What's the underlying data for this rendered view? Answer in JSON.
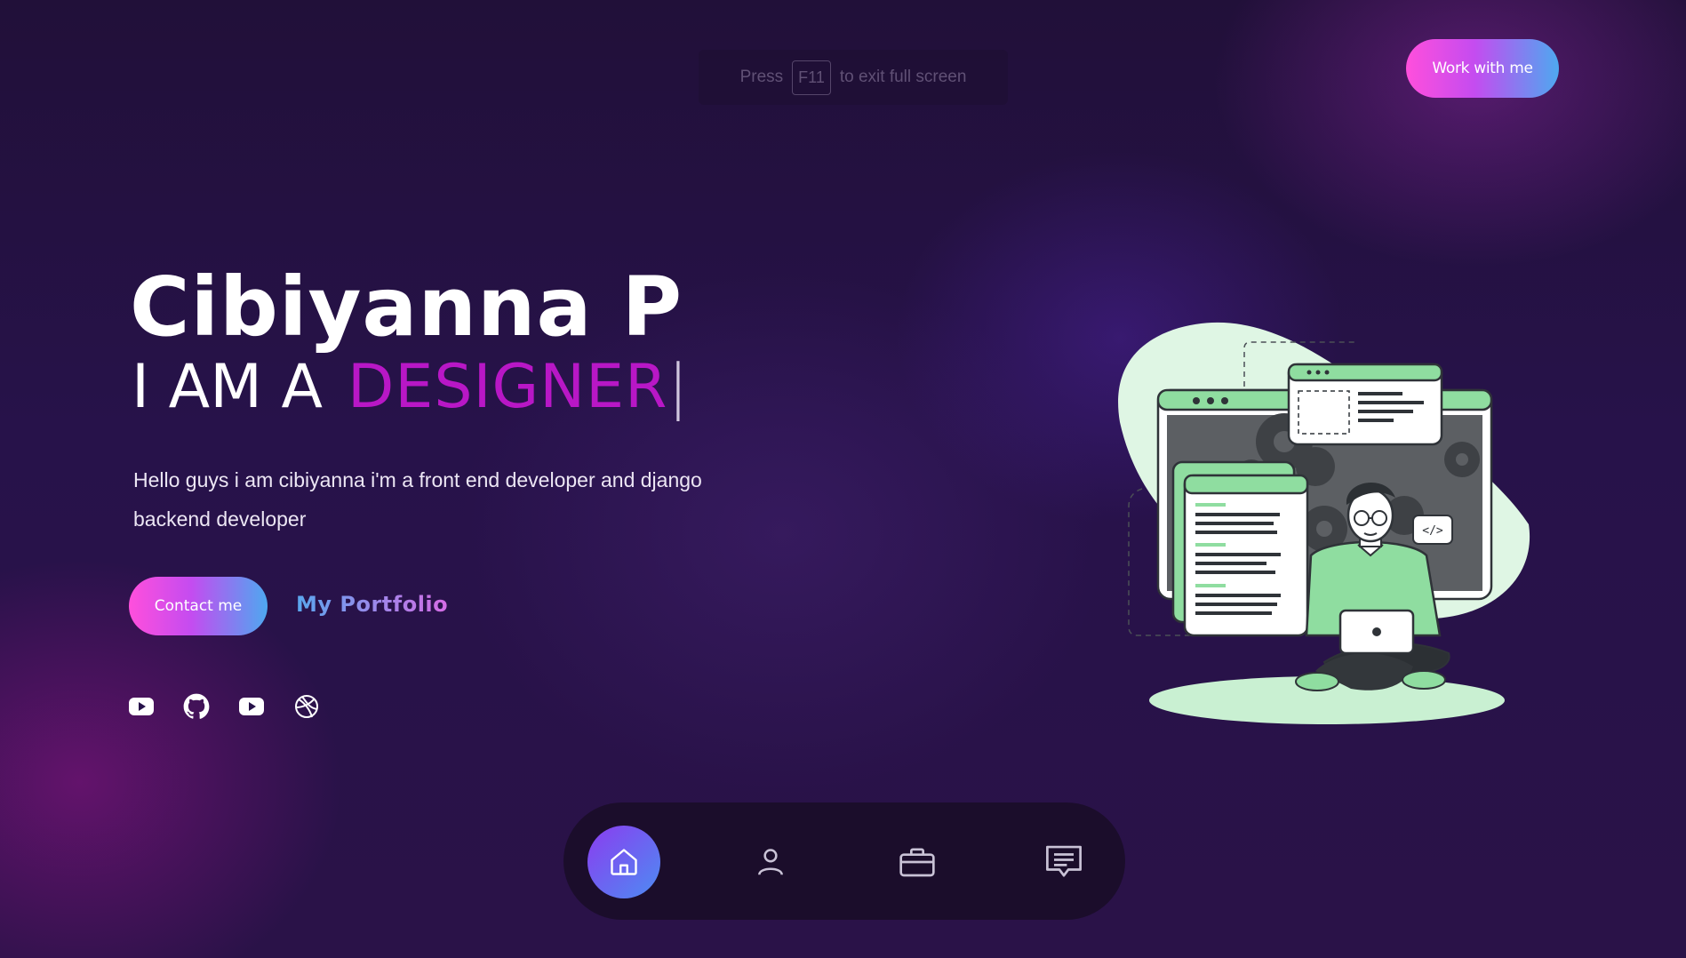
{
  "overlay": {
    "press": "Press",
    "key": "F11",
    "suffix": "to exit full screen"
  },
  "header": {
    "cta_label": "Work with me"
  },
  "hero": {
    "name": "Cibiyanna P",
    "role_prefix": "I AM A",
    "role_word": "DESIGNER",
    "caret": "|",
    "description": "Hello guys i am cibiyanna i'm a front end developer and django backend developer",
    "contact_label": "Contact me",
    "portfolio_label": "My Portfolio"
  },
  "socials": [
    {
      "icon": "youtube-icon"
    },
    {
      "icon": "github-icon"
    },
    {
      "icon": "youtube-icon"
    },
    {
      "icon": "dribbble-icon"
    }
  ],
  "bottom_nav": [
    {
      "icon": "home-icon",
      "active": true
    },
    {
      "icon": "user-icon",
      "active": false
    },
    {
      "icon": "briefcase-icon",
      "active": false
    },
    {
      "icon": "message-icon",
      "active": false
    }
  ],
  "colors": {
    "accent_pink": "#ff4fdc",
    "accent_blue": "#4ea8f0",
    "role_magenta": "#b817c6",
    "illustration_green": "#8fdda0",
    "background": "#241040"
  }
}
